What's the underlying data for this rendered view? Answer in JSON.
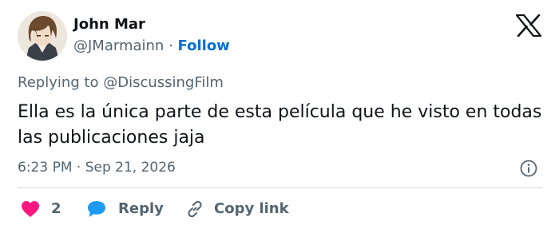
{
  "author": {
    "name": "John Mar",
    "handle": "@JMarmainn",
    "separator": "·",
    "follow_label": "Follow"
  },
  "replying": {
    "prefix": "Replying to",
    "target": "@DiscussingFilm"
  },
  "tweet": {
    "text": "Ella es la única parte de esta película que he visto en todas las publicaciones jaja",
    "time": "6:23 PM",
    "separator": "·",
    "date": "Sep 21, 2026"
  },
  "actions": {
    "like_count": "2",
    "reply_label": "Reply",
    "copy_label": "Copy link"
  },
  "icons": {
    "platform": "x-logo-icon",
    "info": "info-icon",
    "like": "heart-icon",
    "reply": "speech-bubble-icon",
    "copy": "link-icon"
  },
  "colors": {
    "follow": "#006fd6",
    "heart": "#f91880",
    "reply_bubble": "#1d9bf0",
    "secondary_text": "#536471"
  }
}
